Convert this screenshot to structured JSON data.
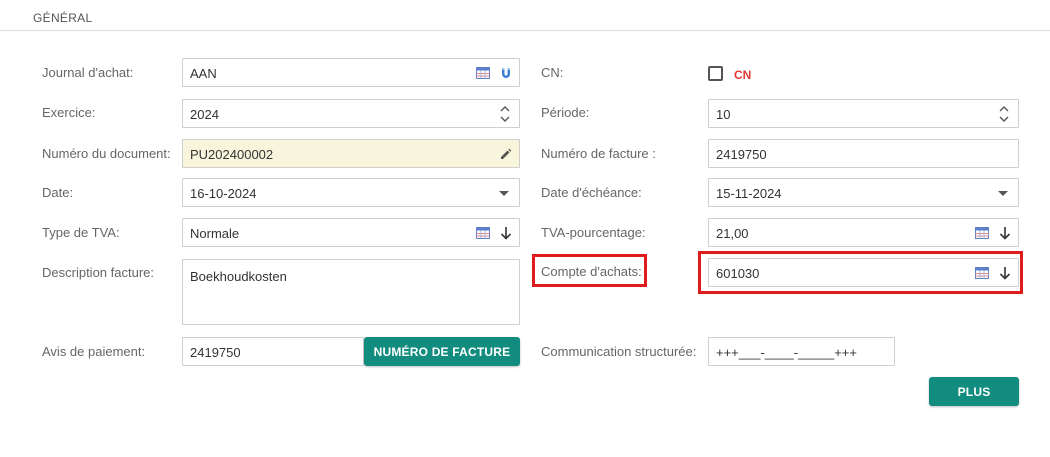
{
  "section": {
    "title": "GÉNÉRAL"
  },
  "left": {
    "journal": {
      "label": "Journal d'achat:",
      "value": "AAN"
    },
    "exercice": {
      "label": "Exercice:",
      "value": "2024"
    },
    "document": {
      "label": "Numéro du document:",
      "value": "PU202400002"
    },
    "date": {
      "label": "Date:",
      "value": "16-10-2024"
    },
    "type_tva": {
      "label": "Type de TVA:",
      "value": "Normale"
    },
    "description": {
      "label": "Description facture:",
      "value": "Boekhoudkosten"
    },
    "avis": {
      "label": "Avis de paiement:",
      "value": "2419750",
      "button_label": "NUMÉRO DE FACTURE"
    }
  },
  "right": {
    "cn": {
      "label": "CN:",
      "checkbox_label": "CN",
      "checked": false
    },
    "periode": {
      "label": "Période:",
      "value": "10"
    },
    "numero_facture": {
      "label": "Numéro de facture :",
      "value": "2419750"
    },
    "echeance": {
      "label": "Date d'échéance:",
      "value": "15-11-2024"
    },
    "tva_pct": {
      "label": "TVA-pourcentage:",
      "value": "21,00"
    },
    "compte": {
      "label": "Compte d'achats:",
      "value": "601030"
    },
    "communication": {
      "label": "Communication structurée:",
      "value": "+++___-____-_____+++"
    },
    "plus_label": "PLUS"
  },
  "icons": {
    "table": "table-icon",
    "magnet": "magnet-icon",
    "pencil": "pencil-icon",
    "arrow_down": "arrow-down-icon",
    "spinner": "spinner-icon",
    "caret": "caret-down-icon"
  },
  "colors": {
    "accent": "#128c7e",
    "highlight": "#e01b1b",
    "cn": "#e53935",
    "yellow_field": "#f7f6dc"
  }
}
